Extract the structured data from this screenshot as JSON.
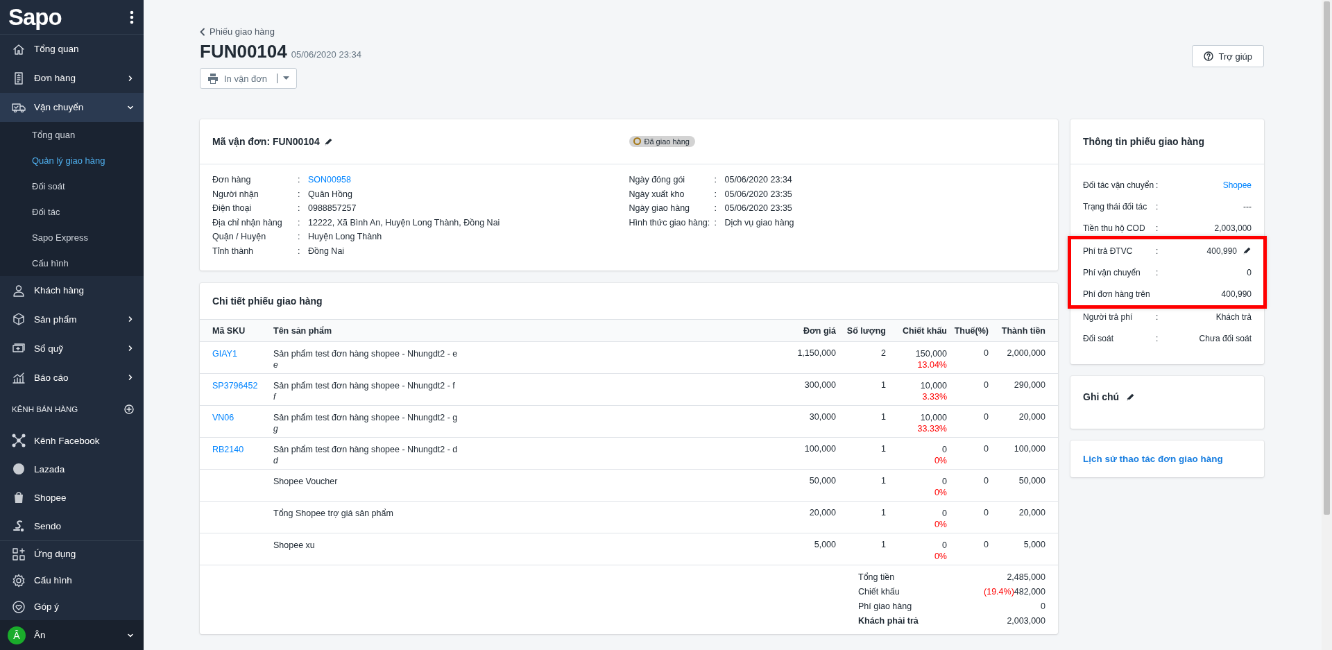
{
  "sidebar": {
    "logo": "Sapo",
    "nav": [
      {
        "label": "Tổng quan",
        "selected": false
      },
      {
        "label": "Đơn hàng",
        "selected": false,
        "expanded": false
      },
      {
        "label": "Vận chuyển",
        "selected": true,
        "expanded": true,
        "children": [
          {
            "label": "Tổng quan",
            "selected": false
          },
          {
            "label": "Quản lý giao hàng",
            "selected": true
          },
          {
            "label": "Đối soát",
            "selected": false
          },
          {
            "label": "Đối tác",
            "selected": false
          },
          {
            "label": "Sapo Express",
            "selected": false
          },
          {
            "label": "Cấu hình",
            "selected": false
          }
        ]
      },
      {
        "label": "Khách hàng",
        "selected": false
      },
      {
        "label": "Sản phẩm",
        "selected": false,
        "expanded": false
      },
      {
        "label": "Sổ quỹ",
        "selected": false,
        "expanded": false
      },
      {
        "label": "Báo cáo",
        "selected": false,
        "expanded": false
      }
    ],
    "channels_heading": "KÊNH BÁN HÀNG",
    "channels": [
      {
        "label": "Kênh Facebook"
      },
      {
        "label": "Lazada"
      },
      {
        "label": "Shopee"
      },
      {
        "label": "Sendo"
      }
    ],
    "apps": [
      {
        "label": "Ứng dụng"
      },
      {
        "label": "Cấu hình"
      },
      {
        "label": "Góp ý"
      }
    ],
    "user": {
      "initial": "Â",
      "name": "Ân"
    }
  },
  "header": {
    "back_link": "Phiếu giao hàng",
    "title": "FUN00104",
    "date": "05/06/2020 23:34",
    "print_button": "In vận đơn",
    "help_button": "Trợ giúp"
  },
  "shipment": {
    "code_label": "Mã vận đơn: FUN00104",
    "status": "Đã giao hàng",
    "left_fields": [
      {
        "label": "Đơn hàng",
        "colon": ":",
        "value": "SON00958",
        "kind": "link"
      },
      {
        "label": "Người nhận",
        "colon": ":",
        "value": "Quân Hồng",
        "kind": "text"
      },
      {
        "label": "Điện thoại",
        "colon": ":",
        "value": "0988857257",
        "kind": "text"
      },
      {
        "label": "Địa chỉ nhận hàng",
        "colon": ":",
        "value": "12222, Xã Bình An, Huyện Long Thành, Đồng Nai",
        "kind": "text"
      },
      {
        "label": "Quận / Huyện",
        "colon": ":",
        "value": "Huyện Long Thành",
        "kind": "text"
      },
      {
        "label": "Tỉnh thành",
        "colon": ":",
        "value": "Đồng Nai",
        "kind": "text"
      }
    ],
    "right_fields": [
      {
        "label": "Ngày đóng gói",
        "colon": ":",
        "value": "05/06/2020 23:34",
        "kind": "text"
      },
      {
        "label": "Ngày xuất kho",
        "colon": ":",
        "value": "05/06/2020 23:35",
        "kind": "text"
      },
      {
        "label": "Ngày giao hàng",
        "colon": ":",
        "value": "05/06/2020 23:35",
        "kind": "text"
      },
      {
        "label": "Hình thức giao hàng:",
        "colon": ":",
        "value": "Dịch vụ giao hàng",
        "kind": "text"
      }
    ]
  },
  "details": {
    "title": "Chi tiết phiếu giao hàng",
    "columns": [
      "Mã SKU",
      "Tên sản phẩm",
      "Đơn giá",
      "Số lượng",
      "Chiết khấu",
      "Thuế(%)",
      "Thành tiền"
    ],
    "rows": [
      {
        "sku": "GIAY1",
        "name": "Sản phẩm test đơn hàng shopee - Nhungdt2 - e",
        "variant": "e",
        "price": "1,150,000",
        "qty": "2",
        "discount": "150,000",
        "discount_pct": "13.04%",
        "tax": "0",
        "total": "2,000,000"
      },
      {
        "sku": "SP3796452",
        "name": "Sản phẩm test đơn hàng shopee - Nhungdt2 - f",
        "variant": "f",
        "price": "300,000",
        "qty": "1",
        "discount": "10,000",
        "discount_pct": "3.33%",
        "tax": "0",
        "total": "290,000"
      },
      {
        "sku": "VN06",
        "name": "Sản phẩm test đơn hàng shopee - Nhungdt2 - g",
        "variant": "g",
        "price": "30,000",
        "qty": "1",
        "discount": "10,000",
        "discount_pct": "33.33%",
        "tax": "0",
        "total": "20,000"
      },
      {
        "sku": "RB2140",
        "name": "Sản phẩm test đơn hàng shopee - Nhungdt2 - d",
        "variant": "d",
        "price": "100,000",
        "qty": "1",
        "discount": "0",
        "discount_pct": "0%",
        "tax": "0",
        "total": "100,000"
      },
      {
        "name": "Shopee Voucher",
        "price": "50,000",
        "qty": "1",
        "discount": "0",
        "discount_pct": "0%",
        "tax": "0",
        "total": "50,000"
      },
      {
        "name": "Tổng Shopee trợ giá sản phẩm",
        "price": "20,000",
        "qty": "1",
        "discount": "0",
        "discount_pct": "0%",
        "tax": "0",
        "total": "20,000"
      },
      {
        "name": "Shopee xu",
        "price": "5,000",
        "qty": "1",
        "discount": "0",
        "discount_pct": "0%",
        "tax": "0",
        "total": "5,000"
      }
    ],
    "summary": [
      {
        "label": "Tổng tiền",
        "value": "2,485,000",
        "bold": false
      },
      {
        "label": "Chiết khấu",
        "pct": "(19.4%)",
        "value": "482,000",
        "bold": false
      },
      {
        "label": "Phí giao hàng",
        "value": "0",
        "bold": false
      },
      {
        "label": "Khách phải trả",
        "value": "2,003,000",
        "bold": true
      }
    ]
  },
  "info": {
    "title": "Thông tin phiếu giao hàng",
    "rows": [
      {
        "label": "Đối tác vận chuyển",
        "colon": ":",
        "value": "Shopee",
        "kind": "link",
        "highlighted": false
      },
      {
        "label": "Trạng thái đối tác",
        "colon": ":",
        "value": "---",
        "kind": "text",
        "highlighted": false
      },
      {
        "label": "Tiền thu hộ COD",
        "colon": ":",
        "value": "2,003,000",
        "kind": "text",
        "highlighted": false
      },
      {
        "label": "Phí trả ĐTVC",
        "colon": ":",
        "value": "400,990",
        "kind": "editable",
        "highlighted": true
      },
      {
        "label": "Phí vận chuyển",
        "colon": ":",
        "value": "0",
        "kind": "text",
        "highlighted": true
      },
      {
        "label": "Phí đơn hàng trên",
        "value": "400,990",
        "kind": "text",
        "highlighted": true
      },
      {
        "label": "Người trả phí",
        "colon": ":",
        "value": "Khách trả",
        "kind": "text",
        "highlighted": false
      },
      {
        "label": "Đối soát",
        "colon": ":",
        "value": "Chưa đối soát",
        "kind": "text",
        "highlighted": false
      }
    ]
  },
  "note": {
    "title": "Ghi chú"
  },
  "history": {
    "link": "Lịch sử thao tác đơn giao hàng"
  }
}
